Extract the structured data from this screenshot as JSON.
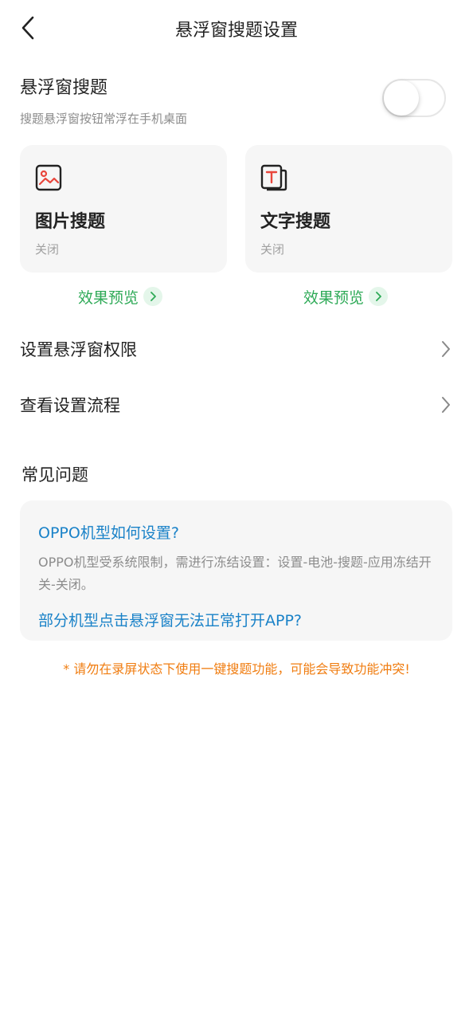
{
  "header": {
    "title": "悬浮窗搜题设置",
    "back_icon": "back-arrow-icon"
  },
  "floating": {
    "title": "悬浮窗搜题",
    "description": "搜题悬浮窗按钮常浮在手机桌面",
    "toggle_on": false
  },
  "cards": [
    {
      "title": "图片搜题",
      "status": "关闭",
      "icon": "image-icon",
      "preview_label": "效果预览"
    },
    {
      "title": "文字搜题",
      "status": "关闭",
      "icon": "text-icon",
      "preview_label": "效果预览"
    }
  ],
  "menu": [
    {
      "label": "设置悬浮窗权限"
    },
    {
      "label": "查看设置流程"
    }
  ],
  "faq": {
    "heading": "常见问题",
    "q1": "OPPO机型如何设置?",
    "a1": "OPPO机型受系统限制，需进行冻结设置：设置-电池-搜题-应用冻结开关-关闭。",
    "q2": "部分机型点击悬浮窗无法正常打开APP?"
  },
  "warning": "* 请勿在录屏状态下使用一键搜题功能，可能会导致功能冲突!",
  "colors": {
    "accent_green": "#2eaa57",
    "link_blue": "#1a82c8",
    "warning_orange": "#f07d11",
    "icon_red": "#e8463c"
  }
}
